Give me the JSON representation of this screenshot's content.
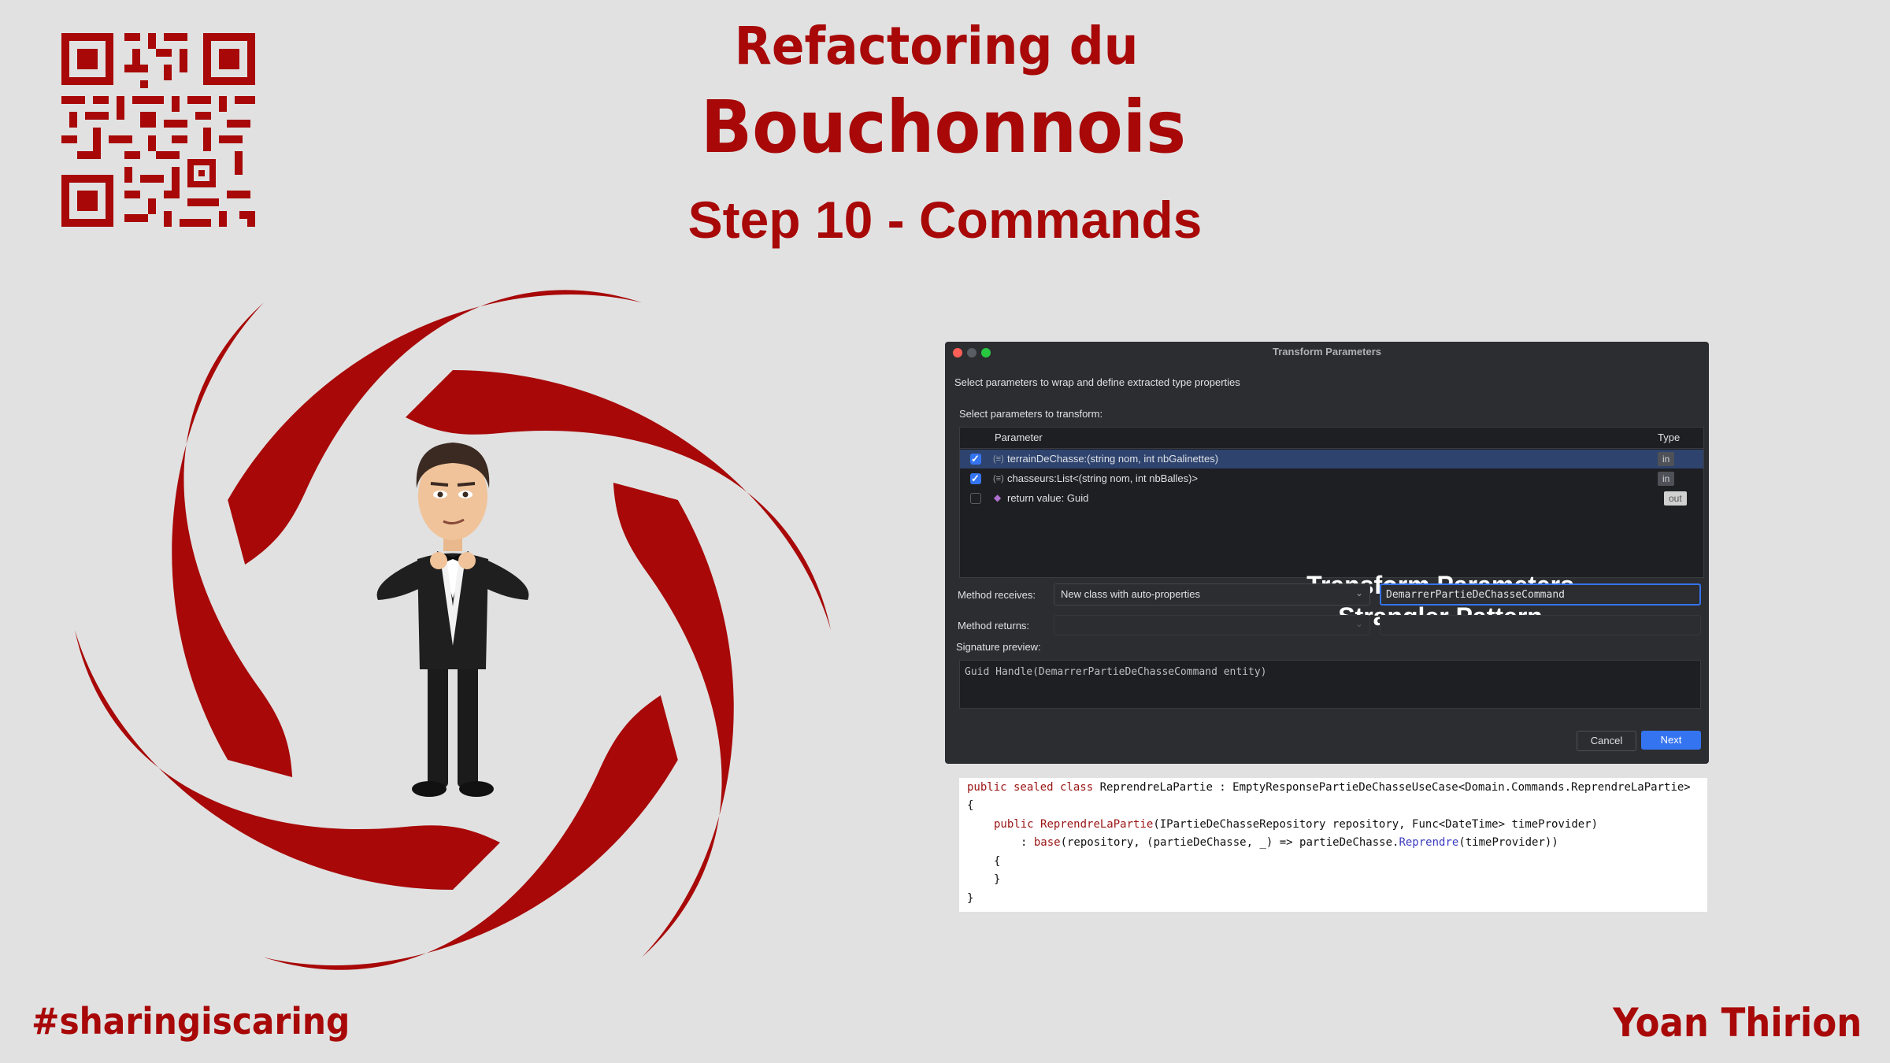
{
  "slide": {
    "title_line1": "Refactoring du",
    "title_line2": "Bouchonnois",
    "subtitle": "Step 10 - Commands",
    "hashtag": "#sharingiscaring",
    "author": "Yoan Thirion",
    "brand_color": "#a80808",
    "background_color": "#e1e1e1",
    "images": [
      "qr-code",
      "spiral-logo",
      "avatar-in-tuxedo"
    ]
  },
  "dialog": {
    "window_title": "Transform Parameters",
    "description": "Select parameters to wrap and define extracted type properties",
    "select_label": "Select parameters to transform:",
    "columns": {
      "parameter": "Parameter",
      "type": "Type"
    },
    "rows": [
      {
        "checked": true,
        "icon": "parameter-icon",
        "label": "terrainDeChasse:(string nom, int nbGalinettes)",
        "type": "in",
        "selected": true
      },
      {
        "checked": true,
        "icon": "parameter-icon",
        "label": "chasseurs:List<(string nom, int nbBalles)>",
        "type": "in",
        "selected": false
      },
      {
        "checked": false,
        "icon": "return-value-icon",
        "label": "return value: Guid",
        "type": "out",
        "selected": false
      }
    ],
    "overlay_line1": "Transform Parameters",
    "overlay_line2": "Strangler Pattern",
    "method_receives_label": "Method receives:",
    "method_receives_value": "New class with auto-properties",
    "class_name_value": "DemarrerPartieDeChasseCommand",
    "method_returns_label": "Method returns:",
    "signature_label": "Signature preview:",
    "signature_value": "Guid Handle(DemarrerPartieDeChasseCommand entity)",
    "cancel_label": "Cancel",
    "next_label": "Next",
    "accent_color": "#3574f0"
  },
  "code": {
    "line1": {
      "kw": "public sealed class",
      "name": " ReprendreLaPartie : EmptyResponsePartieDeChasseUseCase<Domain.Commands.ReprendreLaPartie>"
    },
    "line2": "{",
    "line3": {
      "kw": "public",
      "ctor": "ReprendreLaPartie",
      "rest": "(IPartieDeChasseRepository repository, Func<DateTime> timeProvider)"
    },
    "line4": {
      "pre": ": ",
      "kw": "base",
      "mid": "(repository, (partieDeChasse, _) => partieDeChasse.",
      "method": "Reprendre",
      "end": "(timeProvider))"
    },
    "line5": "{",
    "line6": "}",
    "line7": "}"
  }
}
